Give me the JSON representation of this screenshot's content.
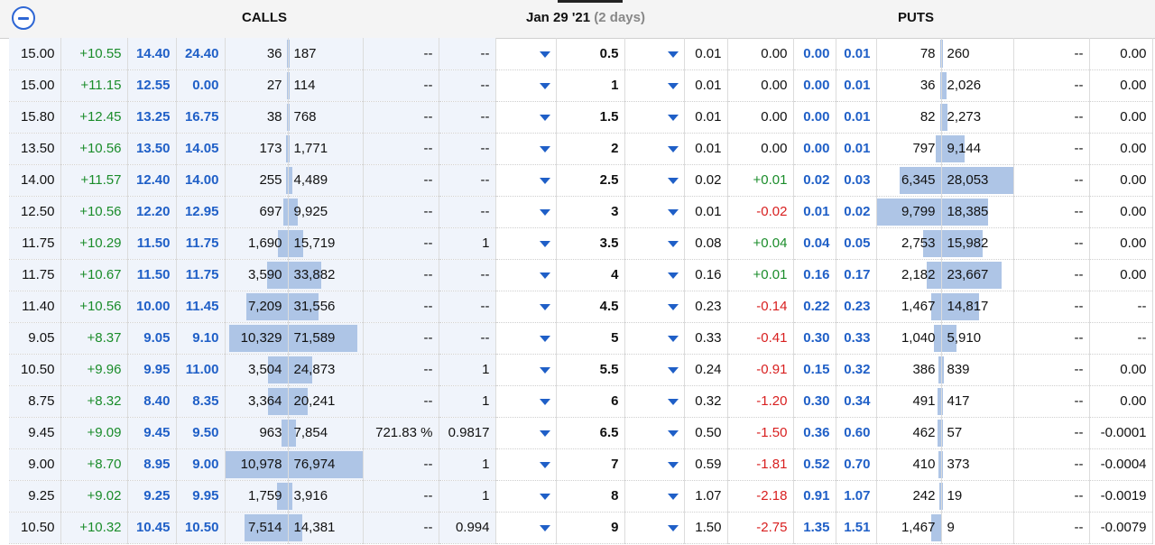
{
  "header": {
    "calls_label": "CALLS",
    "expiry_label": "Jan 29 '21",
    "expiry_days": "(2 days)",
    "puts_label": "PUTS"
  },
  "colors": {
    "accent": "#1f5fc7",
    "positive": "#1a8c2a",
    "negative": "#d81f1f",
    "volume_bar": "#aec5e6"
  },
  "rows": [
    {
      "c_last": "15.00",
      "c_chg": "+10.55",
      "c_bid": "14.40",
      "c_ask": "24.40",
      "c_vol": "36",
      "c_oi": "187",
      "c_iv": "--",
      "c_delta": "--",
      "strike": "0.5",
      "p_last": "0.01",
      "p_chg": "0.00",
      "p_bid": "0.00",
      "p_ask": "0.01",
      "p_vol": "78",
      "p_oi": "260",
      "p_iv": "--",
      "p_delta": "0.00"
    },
    {
      "c_last": "15.00",
      "c_chg": "+11.15",
      "c_bid": "12.55",
      "c_ask": "0.00",
      "c_vol": "27",
      "c_oi": "114",
      "c_iv": "--",
      "c_delta": "--",
      "strike": "1",
      "p_last": "0.01",
      "p_chg": "0.00",
      "p_bid": "0.00",
      "p_ask": "0.01",
      "p_vol": "36",
      "p_oi": "2,026",
      "p_iv": "--",
      "p_delta": "0.00"
    },
    {
      "c_last": "15.80",
      "c_chg": "+12.45",
      "c_bid": "13.25",
      "c_ask": "16.75",
      "c_vol": "38",
      "c_oi": "768",
      "c_iv": "--",
      "c_delta": "--",
      "strike": "1.5",
      "p_last": "0.01",
      "p_chg": "0.00",
      "p_bid": "0.00",
      "p_ask": "0.01",
      "p_vol": "82",
      "p_oi": "2,273",
      "p_iv": "--",
      "p_delta": "0.00"
    },
    {
      "c_last": "13.50",
      "c_chg": "+10.56",
      "c_bid": "13.50",
      "c_ask": "14.05",
      "c_vol": "173",
      "c_oi": "1,771",
      "c_iv": "--",
      "c_delta": "--",
      "strike": "2",
      "p_last": "0.01",
      "p_chg": "0.00",
      "p_bid": "0.00",
      "p_ask": "0.01",
      "p_vol": "797",
      "p_oi": "9,144",
      "p_iv": "--",
      "p_delta": "0.00"
    },
    {
      "c_last": "14.00",
      "c_chg": "+11.57",
      "c_bid": "12.40",
      "c_ask": "14.00",
      "c_vol": "255",
      "c_oi": "4,489",
      "c_iv": "--",
      "c_delta": "--",
      "strike": "2.5",
      "p_last": "0.02",
      "p_chg": "+0.01",
      "p_bid": "0.02",
      "p_ask": "0.03",
      "p_vol": "6,345",
      "p_oi": "28,053",
      "p_iv": "--",
      "p_delta": "0.00"
    },
    {
      "c_last": "12.50",
      "c_chg": "+10.56",
      "c_bid": "12.20",
      "c_ask": "12.95",
      "c_vol": "697",
      "c_oi": "9,925",
      "c_iv": "--",
      "c_delta": "--",
      "strike": "3",
      "p_last": "0.01",
      "p_chg": "-0.02",
      "p_bid": "0.01",
      "p_ask": "0.02",
      "p_vol": "9,799",
      "p_oi": "18,385",
      "p_iv": "--",
      "p_delta": "0.00"
    },
    {
      "c_last": "11.75",
      "c_chg": "+10.29",
      "c_bid": "11.50",
      "c_ask": "11.75",
      "c_vol": "1,690",
      "c_oi": "15,719",
      "c_iv": "--",
      "c_delta": "1",
      "strike": "3.5",
      "p_last": "0.08",
      "p_chg": "+0.04",
      "p_bid": "0.04",
      "p_ask": "0.05",
      "p_vol": "2,753",
      "p_oi": "15,982",
      "p_iv": "--",
      "p_delta": "0.00"
    },
    {
      "c_last": "11.75",
      "c_chg": "+10.67",
      "c_bid": "11.50",
      "c_ask": "11.75",
      "c_vol": "3,590",
      "c_oi": "33,882",
      "c_iv": "--",
      "c_delta": "--",
      "strike": "4",
      "p_last": "0.16",
      "p_chg": "+0.01",
      "p_bid": "0.16",
      "p_ask": "0.17",
      "p_vol": "2,182",
      "p_oi": "23,667",
      "p_iv": "--",
      "p_delta": "0.00"
    },
    {
      "c_last": "11.40",
      "c_chg": "+10.56",
      "c_bid": "10.00",
      "c_ask": "11.45",
      "c_vol": "7,209",
      "c_oi": "31,556",
      "c_iv": "--",
      "c_delta": "--",
      "strike": "4.5",
      "p_last": "0.23",
      "p_chg": "-0.14",
      "p_bid": "0.22",
      "p_ask": "0.23",
      "p_vol": "1,467",
      "p_oi": "14,817",
      "p_iv": "--",
      "p_delta": "--"
    },
    {
      "c_last": "9.05",
      "c_chg": "+8.37",
      "c_bid": "9.05",
      "c_ask": "9.10",
      "c_vol": "10,329",
      "c_oi": "71,589",
      "c_iv": "--",
      "c_delta": "--",
      "strike": "5",
      "p_last": "0.33",
      "p_chg": "-0.41",
      "p_bid": "0.30",
      "p_ask": "0.33",
      "p_vol": "1,040",
      "p_oi": "5,910",
      "p_iv": "--",
      "p_delta": "--"
    },
    {
      "c_last": "10.50",
      "c_chg": "+9.96",
      "c_bid": "9.95",
      "c_ask": "11.00",
      "c_vol": "3,504",
      "c_oi": "24,873",
      "c_iv": "--",
      "c_delta": "1",
      "strike": "5.5",
      "p_last": "0.24",
      "p_chg": "-0.91",
      "p_bid": "0.15",
      "p_ask": "0.32",
      "p_vol": "386",
      "p_oi": "839",
      "p_iv": "--",
      "p_delta": "0.00"
    },
    {
      "c_last": "8.75",
      "c_chg": "+8.32",
      "c_bid": "8.40",
      "c_ask": "8.35",
      "c_vol": "3,364",
      "c_oi": "20,241",
      "c_iv": "--",
      "c_delta": "1",
      "strike": "6",
      "p_last": "0.32",
      "p_chg": "-1.20",
      "p_bid": "0.30",
      "p_ask": "0.34",
      "p_vol": "491",
      "p_oi": "417",
      "p_iv": "--",
      "p_delta": "0.00"
    },
    {
      "c_last": "9.45",
      "c_chg": "+9.09",
      "c_bid": "9.45",
      "c_ask": "9.50",
      "c_vol": "963",
      "c_oi": "7,854",
      "c_iv": "721.83 %",
      "c_delta": "0.9817",
      "strike": "6.5",
      "p_last": "0.50",
      "p_chg": "-1.50",
      "p_bid": "0.36",
      "p_ask": "0.60",
      "p_vol": "462",
      "p_oi": "57",
      "p_iv": "--",
      "p_delta": "-0.0001"
    },
    {
      "c_last": "9.00",
      "c_chg": "+8.70",
      "c_bid": "8.95",
      "c_ask": "9.00",
      "c_vol": "10,978",
      "c_oi": "76,974",
      "c_iv": "--",
      "c_delta": "1",
      "strike": "7",
      "p_last": "0.59",
      "p_chg": "-1.81",
      "p_bid": "0.52",
      "p_ask": "0.70",
      "p_vol": "410",
      "p_oi": "373",
      "p_iv": "--",
      "p_delta": "-0.0004"
    },
    {
      "c_last": "9.25",
      "c_chg": "+9.02",
      "c_bid": "9.25",
      "c_ask": "9.95",
      "c_vol": "1,759",
      "c_oi": "3,916",
      "c_iv": "--",
      "c_delta": "1",
      "strike": "8",
      "p_last": "1.07",
      "p_chg": "-2.18",
      "p_bid": "0.91",
      "p_ask": "1.07",
      "p_vol": "242",
      "p_oi": "19",
      "p_iv": "--",
      "p_delta": "-0.0019"
    },
    {
      "c_last": "10.50",
      "c_chg": "+10.32",
      "c_bid": "10.45",
      "c_ask": "10.50",
      "c_vol": "7,514",
      "c_oi": "14,381",
      "c_iv": "--",
      "c_delta": "0.994",
      "strike": "9",
      "p_last": "1.50",
      "p_chg": "-2.75",
      "p_bid": "1.35",
      "p_ask": "1.51",
      "p_vol": "1,467",
      "p_oi": "9",
      "p_iv": "--",
      "p_delta": "-0.0079"
    }
  ]
}
